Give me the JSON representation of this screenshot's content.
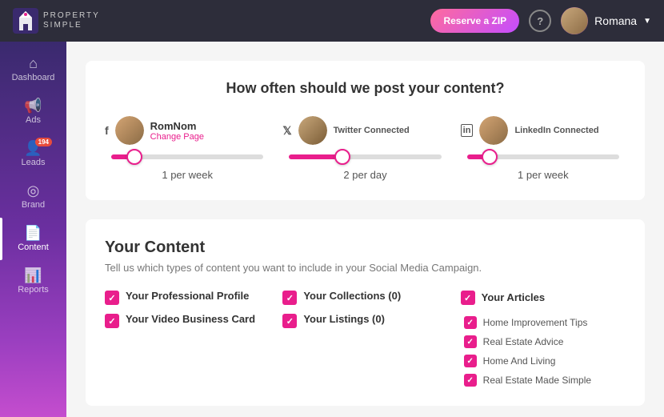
{
  "header": {
    "logo_text": "PROPERTY",
    "logo_sub": "SIMPLE",
    "reserve_btn": "Reserve a ZIP",
    "help_icon": "?",
    "user_name": "Romana"
  },
  "sidebar": {
    "items": [
      {
        "id": "dashboard",
        "label": "Dashboard",
        "icon": "⌂",
        "active": false
      },
      {
        "id": "ads",
        "label": "Ads",
        "icon": "📢",
        "active": false
      },
      {
        "id": "leads",
        "label": "Leads",
        "icon": "👤",
        "active": false,
        "badge": "194"
      },
      {
        "id": "brand",
        "label": "Brand",
        "icon": "◎",
        "active": false
      },
      {
        "id": "content",
        "label": "Content",
        "icon": "📄",
        "active": true
      },
      {
        "id": "reports",
        "label": "Reports",
        "icon": "📊",
        "active": false
      }
    ]
  },
  "posting_section": {
    "title": "How often should we post your content?",
    "accounts": [
      {
        "platform": "f",
        "name": "RomNom",
        "sub": "Change Page",
        "connected": false,
        "frequency": "1 per week",
        "fill_pct": "15%",
        "thumb_pos": "15%",
        "avatar_color": "#c9a87c"
      },
      {
        "platform": "t",
        "name": "Twitter Connected",
        "sub": "",
        "connected": true,
        "frequency": "2 per day",
        "fill_pct": "35%",
        "thumb_pos": "35%",
        "avatar_color": "#8b6b45"
      },
      {
        "platform": "in",
        "name": "LinkedIn Connected",
        "sub": "",
        "connected": true,
        "frequency": "1 per week",
        "fill_pct": "15%",
        "thumb_pos": "15%",
        "avatar_color": "#c9a87c"
      }
    ]
  },
  "content_section": {
    "title": "Your Content",
    "subtitle": "Tell us which types of content you want to include in your Social Media Campaign.",
    "col1": [
      {
        "label": "Your Professional Profile",
        "checked": true
      },
      {
        "label": "Your Video Business Card",
        "checked": true
      }
    ],
    "col2": [
      {
        "label": "Your Collections (0)",
        "checked": true
      },
      {
        "label": "Your Listings (0)",
        "checked": true
      }
    ],
    "col3": {
      "header": "Your Articles",
      "items": [
        {
          "label": "Home Improvement Tips",
          "checked": true
        },
        {
          "label": "Real Estate Advice",
          "checked": true
        },
        {
          "label": "Home And Living",
          "checked": true
        },
        {
          "label": "Real Estate Made Simple",
          "checked": true
        }
      ]
    }
  }
}
